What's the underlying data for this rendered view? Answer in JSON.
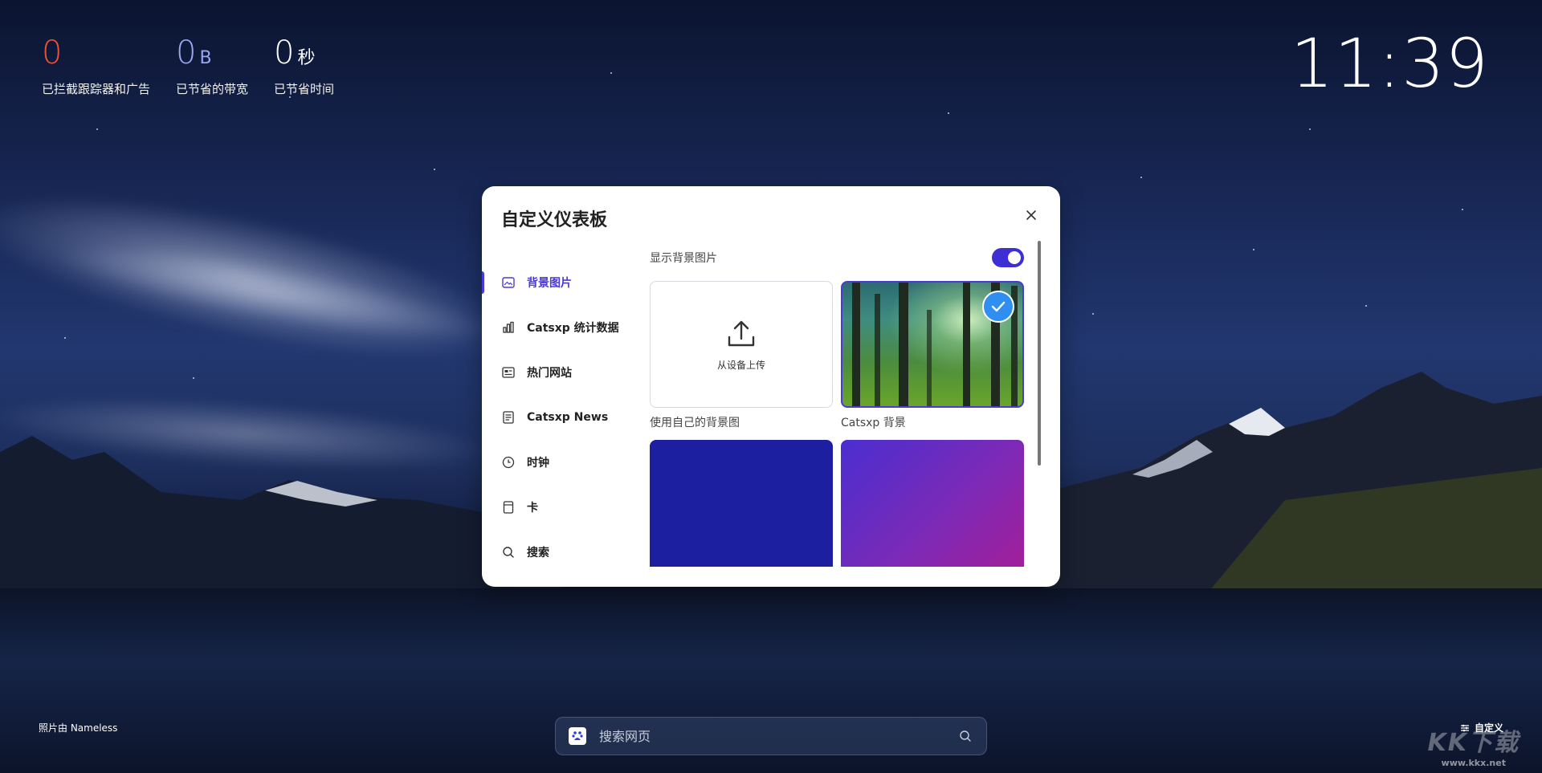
{
  "stats": [
    {
      "value": "0",
      "unit": "",
      "label": "已拦截跟踪器和广告",
      "color": "#e8523a"
    },
    {
      "value": "0",
      "unit": "B",
      "label": "已节省的带宽",
      "color": "#9aa6f0"
    },
    {
      "value": "0",
      "unit": "秒",
      "label": "已节省时间",
      "color": "#ffffff"
    }
  ],
  "clock": "11:39",
  "modal": {
    "title": "自定义仪表板",
    "nav": [
      {
        "label": "背景图片",
        "icon": "image-icon",
        "active": true
      },
      {
        "label": "Catsxp 统计数据",
        "icon": "bar-chart-icon"
      },
      {
        "label": "热门网站",
        "icon": "top-sites-icon"
      },
      {
        "label": "Catsxp News",
        "icon": "news-icon"
      },
      {
        "label": "时钟",
        "icon": "clock-icon"
      },
      {
        "label": "卡",
        "icon": "card-icon"
      },
      {
        "label": "搜索",
        "icon": "search-icon"
      }
    ],
    "show_background_label": "显示背景图片",
    "show_background_enabled": true,
    "upload_text": "从设备上传",
    "upload_caption": "使用自己的背景图",
    "catsxp_caption": "Catsxp 背景",
    "accent_color": "#4a3ad6"
  },
  "bottom": {
    "photo_credit": "照片由 Nameless",
    "search_placeholder": "搜索网页",
    "customize_label": "自定义"
  },
  "watermark": {
    "logo": "KK下载",
    "url": "www.kkx.net"
  }
}
